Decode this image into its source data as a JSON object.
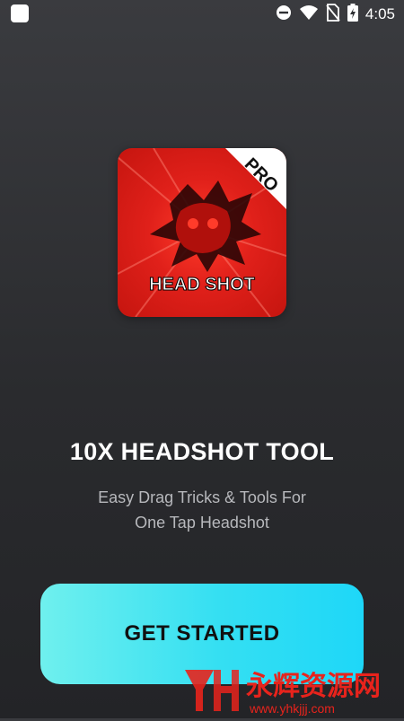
{
  "status_bar": {
    "time": "4:05",
    "icons": [
      "app-icon",
      "do-not-disturb-icon",
      "wifi-icon",
      "no-sim-icon",
      "battery-charging-icon"
    ]
  },
  "app": {
    "logo": {
      "main_text": "HEAD SHOT",
      "badge": "PRO"
    },
    "title": "10X HEADSHOT TOOL",
    "subtitle_line1": "Easy Drag Tricks & Tools For",
    "subtitle_line2": "One Tap Headshot",
    "cta_label": "GET STARTED"
  },
  "watermark": {
    "brand_cn": "永辉资源网",
    "url": "www.yhkjjj.com"
  },
  "colors": {
    "background": "#2e2f33",
    "cta": "#35dff2",
    "logo_red": "#e0201a",
    "text_primary": "#ffffff",
    "text_secondary": "#b7b8bc"
  }
}
